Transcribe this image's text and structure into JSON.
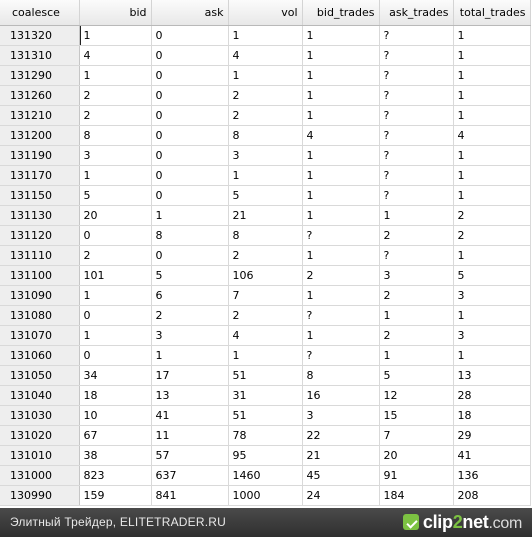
{
  "table": {
    "columns": [
      "coalesce",
      "bid",
      "ask",
      "vol",
      "bid_trades",
      "ask_trades",
      "total_trades"
    ],
    "rows": [
      [
        "131320",
        "1",
        "0",
        "1",
        "1",
        "?",
        "1"
      ],
      [
        "131310",
        "4",
        "0",
        "4",
        "1",
        "?",
        "1"
      ],
      [
        "131290",
        "1",
        "0",
        "1",
        "1",
        "?",
        "1"
      ],
      [
        "131260",
        "2",
        "0",
        "2",
        "1",
        "?",
        "1"
      ],
      [
        "131210",
        "2",
        "0",
        "2",
        "1",
        "?",
        "1"
      ],
      [
        "131200",
        "8",
        "0",
        "8",
        "4",
        "?",
        "4"
      ],
      [
        "131190",
        "3",
        "0",
        "3",
        "1",
        "?",
        "1"
      ],
      [
        "131170",
        "1",
        "0",
        "1",
        "1",
        "?",
        "1"
      ],
      [
        "131150",
        "5",
        "0",
        "5",
        "1",
        "?",
        "1"
      ],
      [
        "131130",
        "20",
        "1",
        "21",
        "1",
        "1",
        "2"
      ],
      [
        "131120",
        "0",
        "8",
        "8",
        "?",
        "2",
        "2"
      ],
      [
        "131110",
        "2",
        "0",
        "2",
        "1",
        "?",
        "1"
      ],
      [
        "131100",
        "101",
        "5",
        "106",
        "2",
        "3",
        "5"
      ],
      [
        "131090",
        "1",
        "6",
        "7",
        "1",
        "2",
        "3"
      ],
      [
        "131080",
        "0",
        "2",
        "2",
        "?",
        "1",
        "1"
      ],
      [
        "131070",
        "1",
        "3",
        "4",
        "1",
        "2",
        "3"
      ],
      [
        "131060",
        "0",
        "1",
        "1",
        "?",
        "1",
        "1"
      ],
      [
        "131050",
        "34",
        "17",
        "51",
        "8",
        "5",
        "13"
      ],
      [
        "131040",
        "18",
        "13",
        "31",
        "16",
        "12",
        "28"
      ],
      [
        "131030",
        "10",
        "41",
        "51",
        "3",
        "15",
        "18"
      ],
      [
        "131020",
        "67",
        "11",
        "78",
        "22",
        "7",
        "29"
      ],
      [
        "131010",
        "38",
        "57",
        "95",
        "21",
        "20",
        "41"
      ],
      [
        "131000",
        "823",
        "637",
        "1460",
        "45",
        "91",
        "136"
      ],
      [
        "130990",
        "159",
        "841",
        "1000",
        "24",
        "184",
        "208"
      ]
    ]
  },
  "footer": {
    "caption": "Элитный Трейдер, ELITETRADER.RU",
    "logo_part1": "clip",
    "logo_part2": "2",
    "logo_part3": "net",
    "logo_tld": ".com"
  },
  "colors": {
    "header_bg": "#ececec",
    "row_header_bg": "#eeeeee",
    "grid_line": "#d9d9d9",
    "footer_bg": "#3a3a3a",
    "logo_accent": "#7cc242"
  },
  "icons": {
    "logo": "clip2net-check-icon"
  }
}
